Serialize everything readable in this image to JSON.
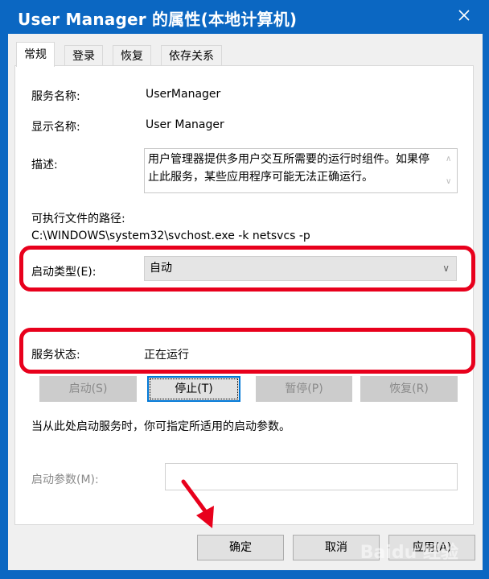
{
  "window": {
    "title": "User Manager 的属性(本地计算机)",
    "close_icon": "close-icon"
  },
  "tabs": [
    {
      "label": "常规",
      "active": true
    },
    {
      "label": "登录",
      "active": false
    },
    {
      "label": "恢复",
      "active": false
    },
    {
      "label": "依存关系",
      "active": false
    }
  ],
  "general": {
    "service_name_label": "服务名称:",
    "service_name_value": "UserManager",
    "display_name_label": "显示名称:",
    "display_name_value": "User Manager",
    "description_label": "描述:",
    "description_value": "用户管理器提供多用户交互所需要的运行时组件。如果停止此服务，某些应用程序可能无法正确运行。",
    "exe_path_label": "可执行文件的路径:",
    "exe_path_value": "C:\\WINDOWS\\system32\\svchost.exe -k netsvcs -p",
    "startup_type_label": "启动类型(E):",
    "startup_type_value": "自动",
    "service_status_label": "服务状态:",
    "service_status_value": "正在运行",
    "start_button": "启动(S)",
    "stop_button": "停止(T)",
    "pause_button": "暂停(P)",
    "resume_button": "恢复(R)",
    "hint_text": "当从此处启动服务时，你可指定所适用的启动参数。",
    "start_params_label": "启动参数(M):",
    "start_params_value": ""
  },
  "footer": {
    "ok_button": "确定",
    "cancel_button": "取消",
    "apply_button": "应用(A)"
  },
  "annotation": {
    "highlight_color": "#e8001c"
  },
  "watermark": "Baidu 经验"
}
